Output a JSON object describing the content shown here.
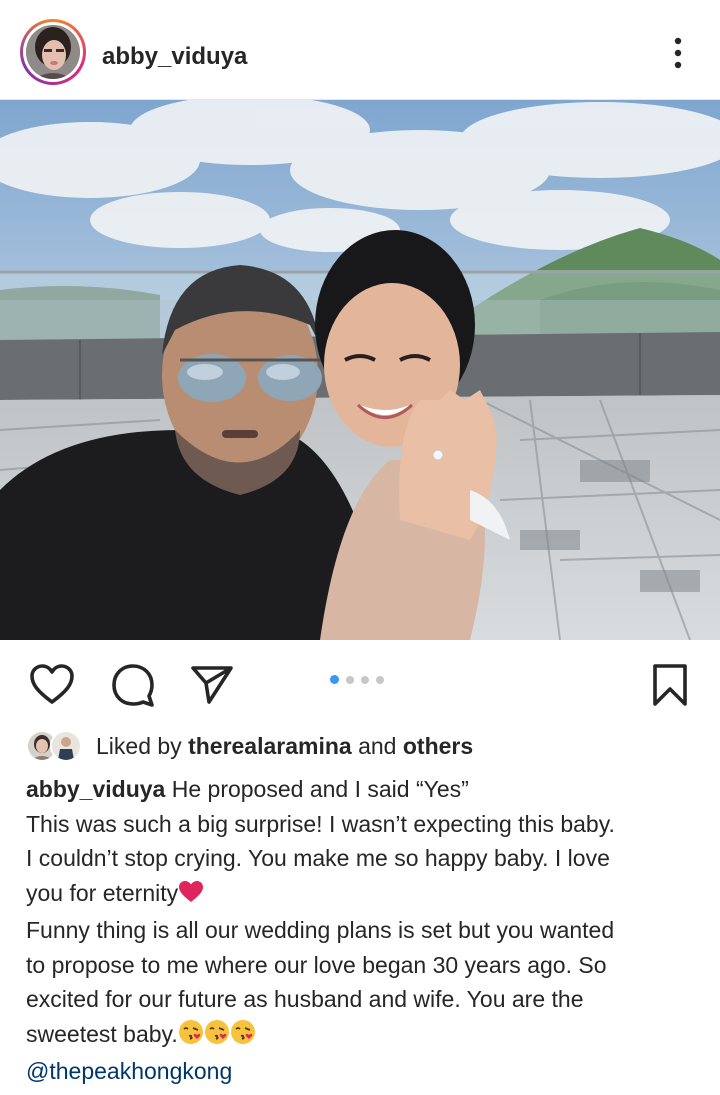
{
  "post": {
    "username": "abby_viduya",
    "carousel_index": 1,
    "carousel_total": 4
  },
  "icons": {
    "more": "more-vertical-icon",
    "like": "heart-icon",
    "comment": "comment-icon",
    "share": "paper-plane-icon",
    "save": "bookmark-icon"
  },
  "colors": {
    "accent": "#3897f0",
    "mention": "#00376b",
    "text": "#262626",
    "heart": "#e0245e"
  },
  "likes": {
    "prefix": "Liked by ",
    "user": "therealaramina",
    "middle": " and ",
    "suffix": "others"
  },
  "caption": {
    "user": "abby_viduya",
    "line1": " He proposed and I said “Yes”",
    "line2": "This was such a big surprise! I wasn’t expecting this baby.",
    "line3": "I couldn’t stop crying. You make me so happy baby. I love",
    "line4": "you for eternity",
    "line5": "Funny thing is all our wedding plans is set but you wanted",
    "line6": "to propose to me where our love began 30 years ago. So",
    "line7": "excited for our future as husband and wife. You are the",
    "line8": "sweetest baby.",
    "mention": "@thepeakhongkong"
  }
}
